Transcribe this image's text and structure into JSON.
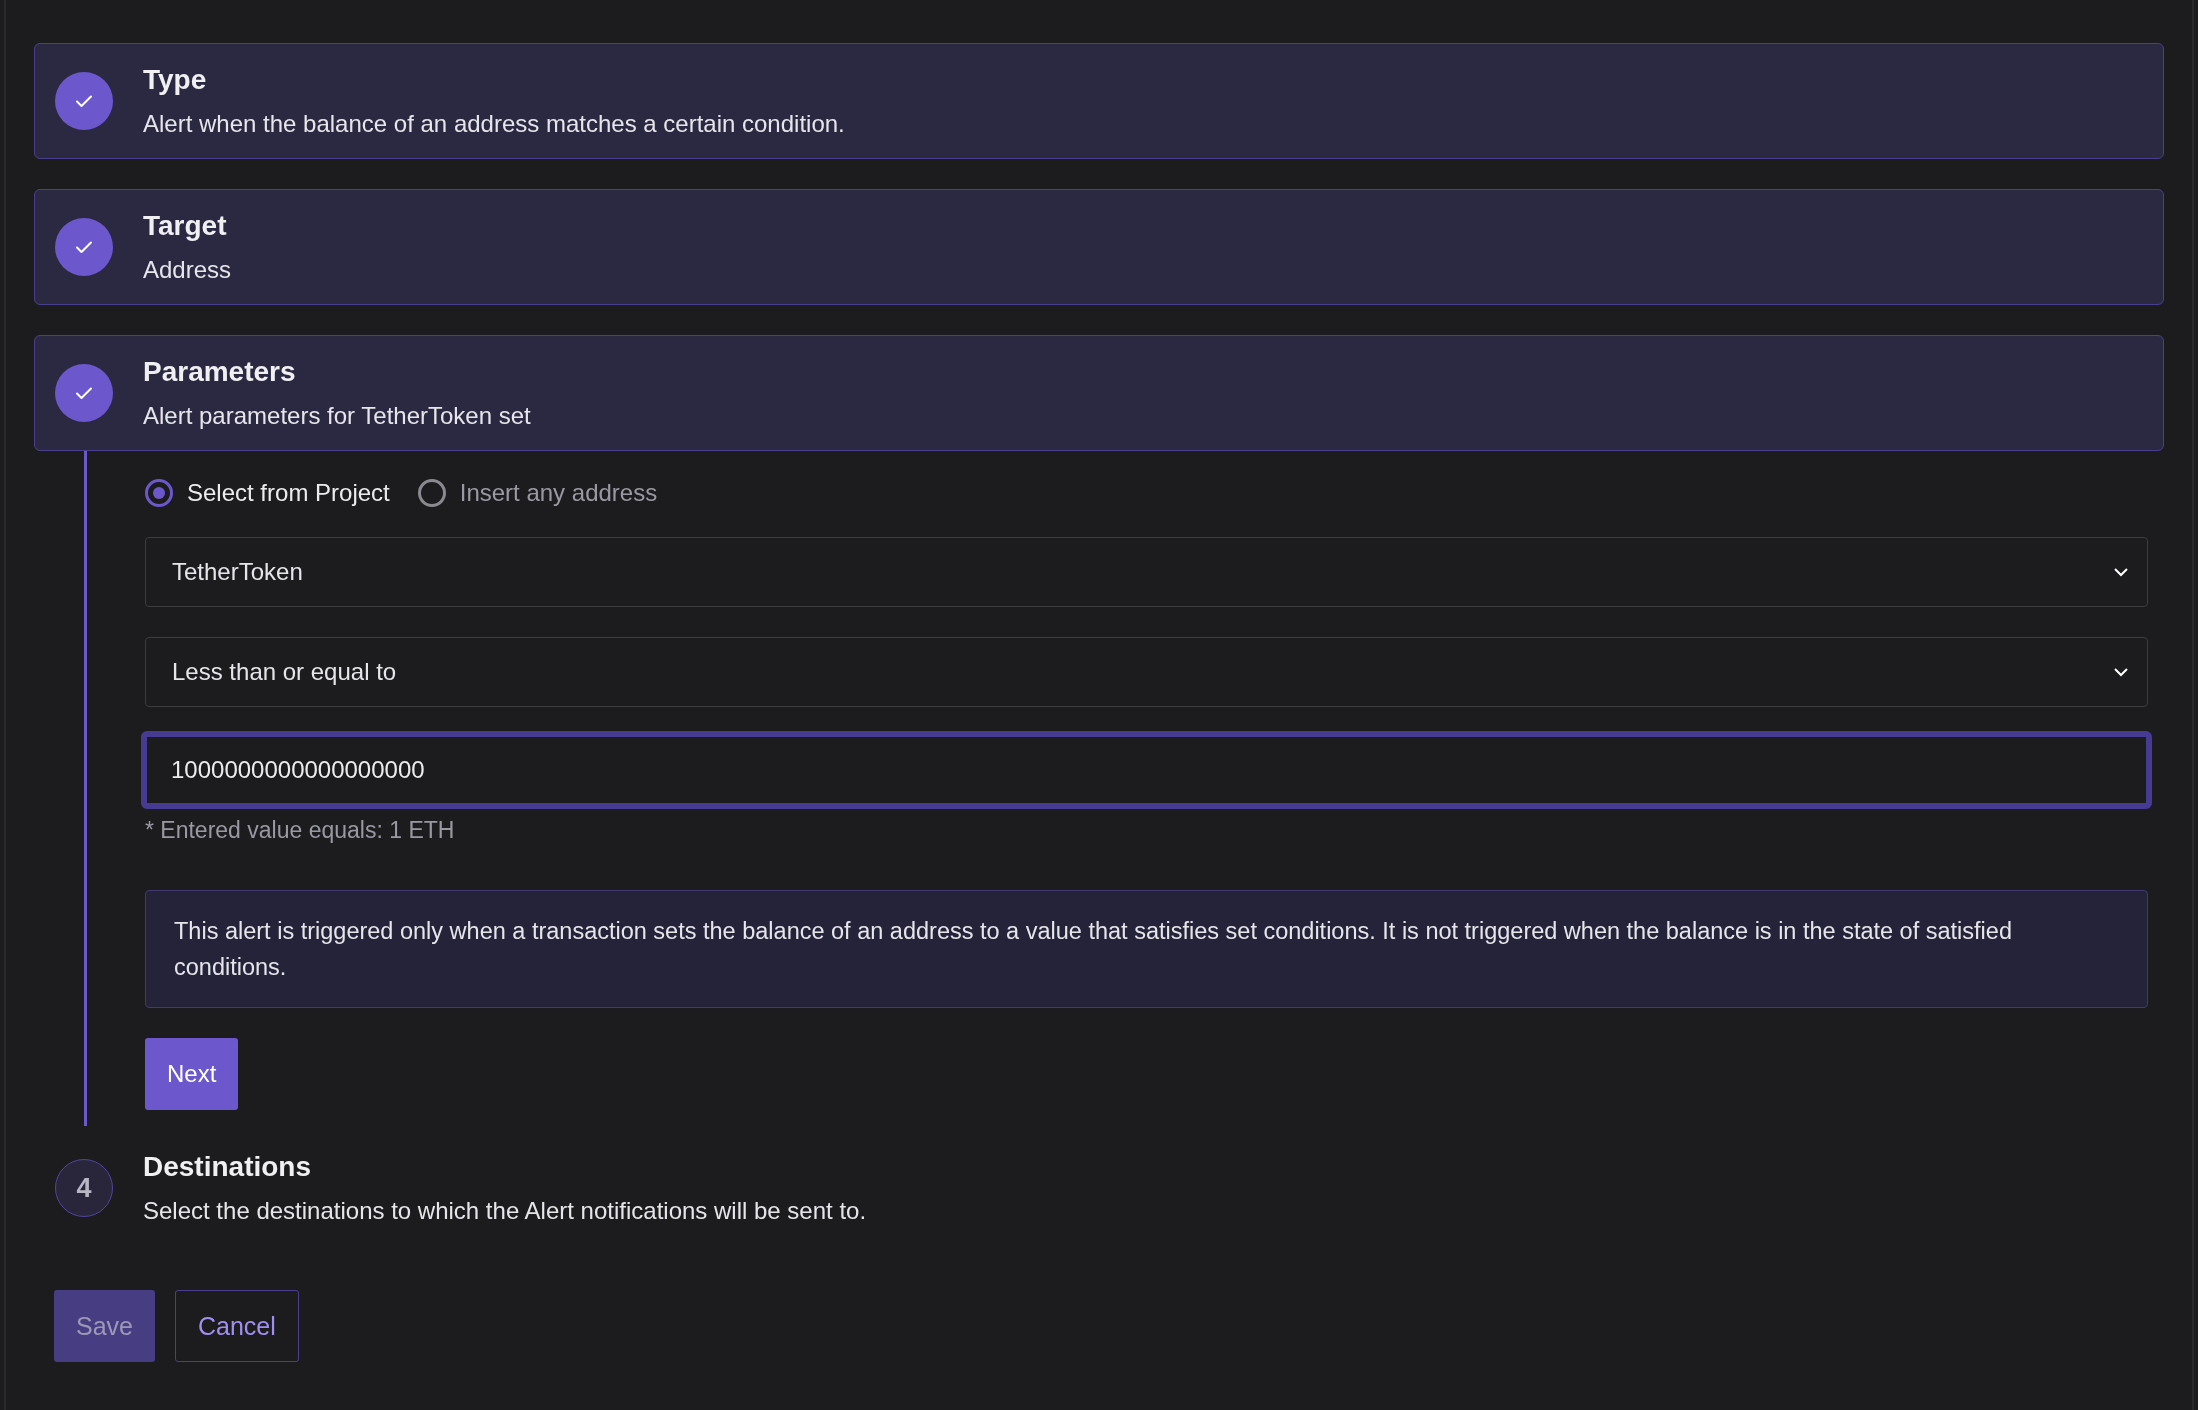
{
  "steps": [
    {
      "title": "Type",
      "description": "Alert when the balance of an address matches a certain condition.",
      "completed": true
    },
    {
      "title": "Target",
      "description": "Address",
      "completed": true
    },
    {
      "title": "Parameters",
      "description": "Alert parameters for TetherToken set",
      "completed": true,
      "expanded": true
    },
    {
      "number": "4",
      "title": "Destinations",
      "description": "Select the destinations to which the Alert notifications will be sent to.",
      "completed": false
    }
  ],
  "parameters": {
    "source_options": [
      {
        "label": "Select from Project",
        "selected": true
      },
      {
        "label": "Insert any address",
        "selected": false
      }
    ],
    "contract_select": {
      "value": "TetherToken"
    },
    "condition_select": {
      "value": "Less than or equal to"
    },
    "value_input": {
      "value": "1000000000000000000",
      "focused": true
    },
    "hint": "* Entered value equals: 1 ETH",
    "info": "This alert is triggered only when a transaction sets the balance of an address to a value that satisfies set conditions. It is not triggered when the balance is in the state of satisfied conditions.",
    "next_button": "Next"
  },
  "actions": [
    {
      "label": "Save",
      "kind": "primary",
      "disabled": true
    },
    {
      "label": "Cancel",
      "kind": "secondary",
      "disabled": false
    }
  ]
}
